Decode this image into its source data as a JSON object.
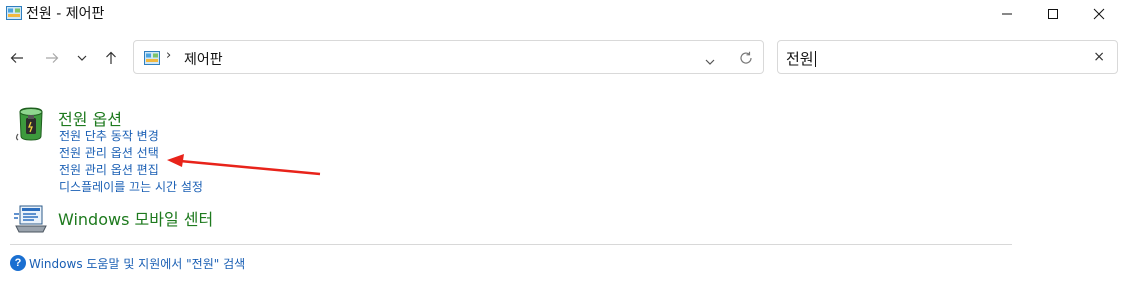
{
  "window": {
    "title": "전원 - 제어판",
    "icon": "control-panel-icon",
    "controls": [
      "minimize-icon",
      "maximize-icon",
      "close-icon"
    ]
  },
  "nav": {
    "back_icon": "arrow-left-icon",
    "forward_icon": "arrow-right-icon",
    "recent_icon": "chevron-down-icon",
    "up_icon": "arrow-up-icon",
    "address": {
      "separator": "›",
      "crumb": "제어판",
      "dropdown_icon": "chevron-down-icon",
      "refresh_icon": "refresh-icon"
    },
    "search": {
      "value": "전원",
      "clear": "×"
    }
  },
  "groups": [
    {
      "title": "전원 옵션",
      "icon": "power-options-icon",
      "links": [
        "전원 단추 동작 변경",
        "전원 관리 옵션 선택",
        "전원 관리 옵션 편집",
        "디스플레이를 끄는 시간 설정"
      ]
    },
    {
      "title": "Windows 모바일 센터",
      "icon": "mobility-center-icon",
      "links": []
    }
  ],
  "help": {
    "icon": "help-icon",
    "text": "Windows 도움말 및 지원에서 \"전원\" 검색"
  },
  "annotation": {
    "arrow_color": "#e8231a"
  },
  "colors": {
    "group_title": "#1e7a1e",
    "link": "#1a5fb4"
  }
}
